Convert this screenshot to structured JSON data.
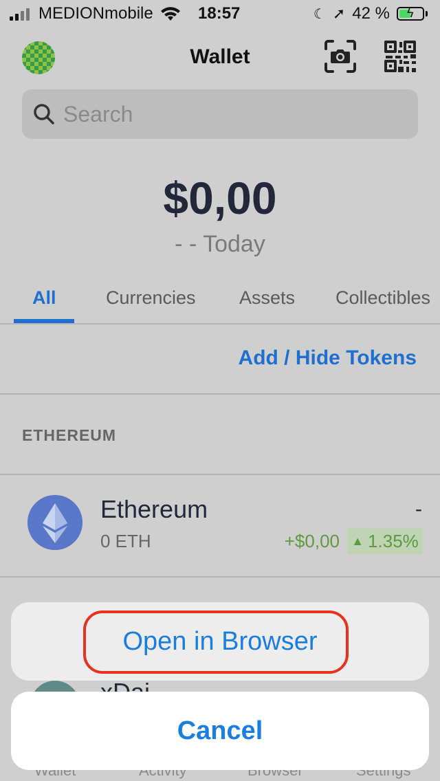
{
  "status_bar": {
    "carrier": "MEDIONmobile",
    "time": "18:57",
    "battery": "42 %"
  },
  "header": {
    "title": "Wallet",
    "camera_icon": "camera-icon",
    "qr_icon": "qr-code-icon"
  },
  "search": {
    "placeholder": "Search"
  },
  "balance": {
    "amount": "$0,00",
    "change": "- - Today"
  },
  "tabs": [
    {
      "label": "All",
      "active": true
    },
    {
      "label": "Currencies"
    },
    {
      "label": "Assets"
    },
    {
      "label": "Collectibles"
    }
  ],
  "add_hide_tokens": "Add / Hide Tokens",
  "section_title": "ETHEREUM",
  "tokens": [
    {
      "name": "Ethereum",
      "balance": "0 ETH",
      "value": "-",
      "change": "+$0,00",
      "percent": "1.35%"
    },
    {
      "name": "xDai"
    }
  ],
  "bottom_nav": [
    "Wallet",
    "Activity",
    "Browser",
    "Settings"
  ],
  "action_sheet": {
    "option": "Open in Browser",
    "cancel": "Cancel"
  },
  "colors": {
    "accent": "#1f6fd1",
    "positive": "#5e9a3e",
    "highlight": "#e8311f"
  }
}
